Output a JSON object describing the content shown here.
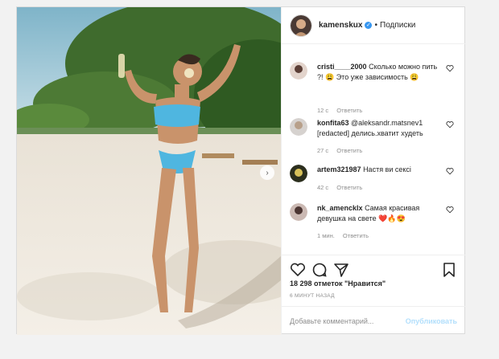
{
  "post": {
    "username": "kamenskux",
    "dot": "•",
    "follow_label": "Подписки",
    "likes": "18 298 отметок \"Нравится\"",
    "time": "6 МИНУТ НАЗАД",
    "add_comment_placeholder": "Добавьте комментарий...",
    "post_button": "Опубликовать"
  },
  "comments": [
    {
      "user": "cristi____2000",
      "text": "Сколько можно пить ?! 😩 Это уже зависимость 😩",
      "age": "12 с",
      "reply": "Ответить"
    },
    {
      "user": "konfita63",
      "text": "@aleksandr.matsnev1 [redacted] делись.хватит худеть",
      "age": "27 с",
      "reply": "Ответить"
    },
    {
      "user": "artem321987",
      "text": "Настя ви сексі",
      "age": "42 с",
      "reply": "Ответить"
    },
    {
      "user": "nk_amencklx",
      "text": "Самая красивая девушка на свете ❤️🔥😍",
      "age": "1 мин.",
      "reply": "Ответить"
    }
  ],
  "colors": {
    "accent": "#3897f0",
    "post_disabled": "#b2dffc"
  }
}
